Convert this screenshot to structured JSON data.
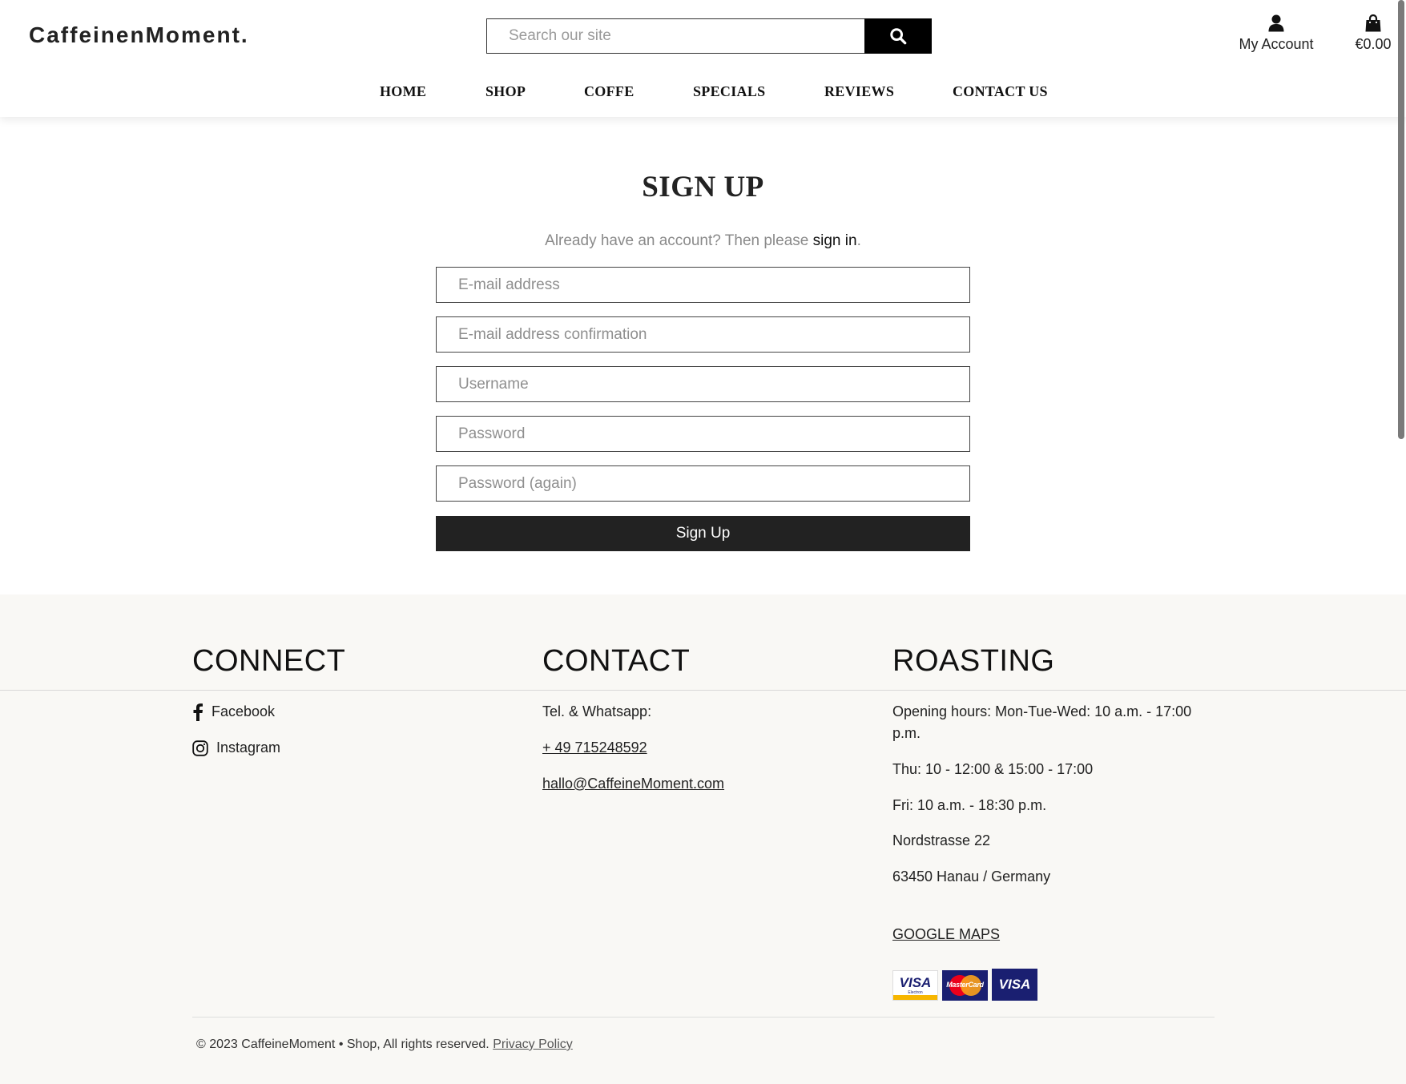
{
  "header": {
    "logo": "CaffeinenMoment.",
    "search_placeholder": "Search our site",
    "account_label": "My Account",
    "cart_total": "€0.00"
  },
  "nav": {
    "items": [
      "HOME",
      "SHOP",
      "COFFE",
      "SPECIALS",
      "REVIEWS",
      "CONTACT US"
    ]
  },
  "main": {
    "title": "SIGN UP",
    "subtitle_prefix": "Already have an account? Then please ",
    "subtitle_link": "sign in",
    "subtitle_suffix": ".",
    "fields": {
      "email": "E-mail address",
      "email_confirm": "E-mail address confirmation",
      "username": "Username",
      "password": "Password",
      "password_again": "Password (again)"
    },
    "submit_label": "Sign Up"
  },
  "footer": {
    "connect": {
      "heading": "CONNECT",
      "facebook": "Facebook",
      "instagram": "Instagram"
    },
    "contact": {
      "heading": "CONTACT",
      "tel_label": "Tel. & Whatsapp:",
      "phone": "+ 49 715248592",
      "email": "hallo@CaffeineMoment.com"
    },
    "roasting": {
      "heading": "ROASTING",
      "hours": "Opening hours: Mon-Tue-Wed: 10 a.m. - 17:00 p.m.",
      "thu": "Thu: 10 - 12:00 & 15:00 - 17:00",
      "fri": "Fri: 10 a.m. - 18:30 p.m.",
      "street": "Nordstrasse 22",
      "city": "63450 Hanau / Germany",
      "maps_link": "GOOGLE MAPS"
    },
    "payment_cards": {
      "visa_electron": "VISA",
      "visa_electron_sub": "Electron",
      "mastercard": "MasterCard",
      "visa": "VISA"
    },
    "copyright": "© 2023 CaffeineMoment • Shop, All rights reserved.",
    "privacy_link": "Privacy Policy"
  },
  "colors": {
    "button_dark": "#222222",
    "footer_bg": "#f9f8f5",
    "visa_blue": "#1a1f71",
    "visa_gold": "#f7b600",
    "mastercard_red": "#eb001b",
    "mastercard_orange": "#f79e1b"
  }
}
